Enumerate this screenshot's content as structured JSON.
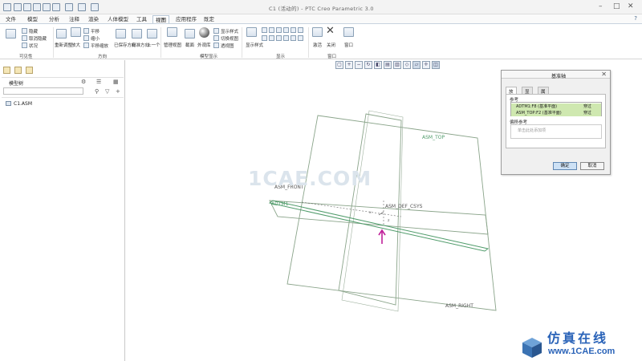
{
  "window": {
    "title": "C1 (活动的) - PTC Creo Parametric 3.0"
  },
  "menu": {
    "tabs": [
      "文件",
      "模型",
      "分析",
      "注释",
      "渲染",
      "人体模型",
      "工具",
      "视图",
      "应用程序",
      "既定"
    ],
    "active_tab": "视图"
  },
  "ribbon": {
    "visibility_small": [
      "隐藏",
      "取消隐藏",
      "状况"
    ],
    "refit_label": "重新调整",
    "zoom_in_label": "放大",
    "pan_small": [
      "平移",
      "缩小",
      "平移缩放"
    ],
    "saved_orientations_label": "已保存方向",
    "standard_orientation_label": "标准方向",
    "previous_label": "上一个",
    "manage_views_label": "管理视图",
    "section_label": "截面",
    "appearance_label": "外观库",
    "model_display_small": [
      "显示样式",
      "切换视图",
      "透视图"
    ],
    "show_label": "显示样式",
    "activate_label": "激活",
    "close_label": "关闭",
    "window_label": "窗口",
    "groups": [
      "可见性",
      "方向",
      "模型显示",
      "显示",
      "窗口"
    ]
  },
  "model_tree": {
    "title": "模型树",
    "items": [
      "C1.ASM"
    ]
  },
  "viewport": {
    "labels": {
      "asm_top": "ASM_TOP",
      "asm_front": "ASM_FRONT",
      "adtm1": "ADTM1",
      "asm_def_csys": "ASM_DEF_CSYS",
      "asm_right": "ASM_RIGHT"
    }
  },
  "dialog": {
    "title": "基准轴",
    "tabs": [
      "放置",
      "显示",
      "属性"
    ],
    "active_tab": "放置",
    "references_label": "参考",
    "references": [
      {
        "name": "ADTM1:F8 (基准平面)",
        "constraint": "穿过"
      },
      {
        "name": "ASM_TOP:F2 (基准平面)",
        "constraint": "穿过"
      }
    ],
    "offset_label": "偏移参考",
    "offset_placeholder": "单击此处添加项",
    "ok_label": "确定",
    "cancel_label": "取消"
  },
  "watermark": "1CAE.COM",
  "brand": {
    "cn": "仿真在线",
    "url": "www.1CAE.com"
  },
  "colors": {
    "datum_plane": "#7a9a7a",
    "axis_arrow": "#c0219a",
    "accent_blue": "#2a63b8"
  }
}
